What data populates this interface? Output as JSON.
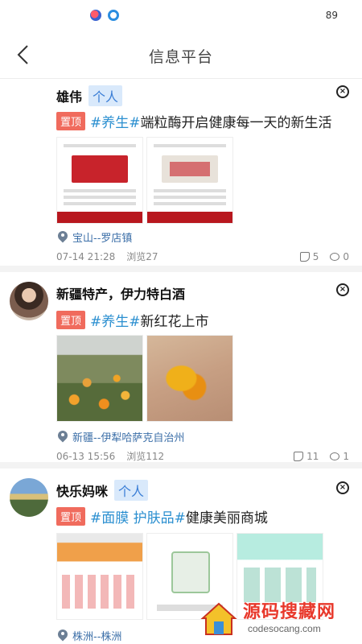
{
  "status_bar": {
    "right": "89",
    "icons": [
      "app-icon-red",
      "app-icon-blue"
    ]
  },
  "navbar": {
    "title": "信息平台",
    "back_icon": "chevron-left-icon"
  },
  "posts": [
    {
      "author": "雄伟",
      "author_tag": "个人",
      "pin_label": "置顶",
      "hashtag": "#养生#",
      "text": "端粒酶开启健康每一天的新生活",
      "location": "宝山--罗店镇",
      "time": "07-14 21:28",
      "views": "浏览27",
      "likes": "5",
      "comments": "0"
    },
    {
      "author": "新疆特产，伊力特白酒",
      "author_tag": "",
      "pin_label": "置顶",
      "hashtag": "#养生#",
      "text": "新红花上市",
      "location": "新疆--伊犁哈萨克自治州",
      "time": "06-13 15:56",
      "views": "浏览112",
      "likes": "11",
      "comments": "1"
    },
    {
      "author": "快乐妈咪",
      "author_tag": "个人",
      "pin_label": "置顶",
      "hashtag": "#面膜 护肤品#",
      "text": "健康美丽商城",
      "location": "株洲--株洲",
      "time": "",
      "views": "",
      "likes": "",
      "comments": ""
    }
  ],
  "watermark": {
    "title": "源码搜藏网",
    "subtitle": "codesocang.com"
  },
  "colors": {
    "pin": "#f06b5d",
    "hashtag": "#2b8fd0",
    "tag_bg": "#d9e9fb",
    "tag_text": "#3b7ed6"
  }
}
